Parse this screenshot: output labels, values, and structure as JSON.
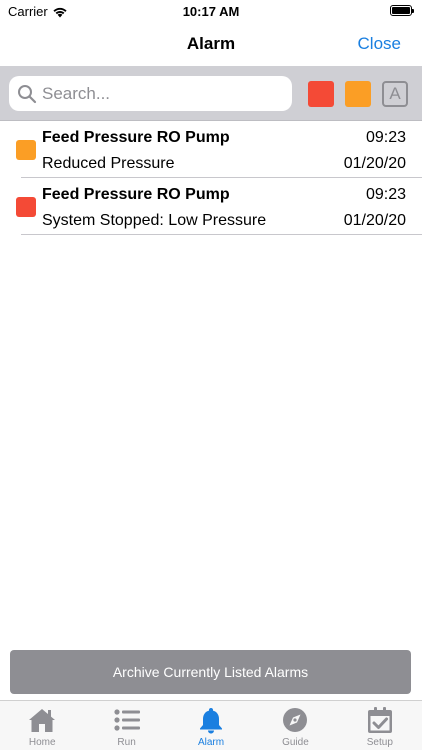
{
  "status_bar": {
    "carrier": "Carrier",
    "time": "10:17 AM"
  },
  "nav": {
    "title": "Alarm",
    "close_label": "Close"
  },
  "search": {
    "placeholder": "Search...",
    "value": ""
  },
  "filters": {
    "all_label": "A",
    "red_color": "#f44a36",
    "orange_color": "#fb9e25"
  },
  "alarms": [
    {
      "title": "Feed Pressure RO Pump",
      "time": "09:23",
      "description": "Reduced Pressure",
      "date": "01/20/20",
      "severity_color": "#fb9e25"
    },
    {
      "title": "Feed Pressure RO Pump",
      "time": "09:23",
      "description": "System Stopped: Low Pressure",
      "date": "01/20/20",
      "severity_color": "#f44a36"
    }
  ],
  "archive_label": "Archive Currently Listed Alarms",
  "tabs": [
    {
      "label": "Home",
      "icon": "home-icon",
      "active": false
    },
    {
      "label": "Run",
      "icon": "list-icon",
      "active": false
    },
    {
      "label": "Alarm",
      "icon": "bell-icon",
      "active": true
    },
    {
      "label": "Guide",
      "icon": "compass-icon",
      "active": false
    },
    {
      "label": "Setup",
      "icon": "calendar-check-icon",
      "active": false
    }
  ],
  "colors": {
    "accent": "#1a7fe0",
    "inactive": "#8e8e93"
  }
}
